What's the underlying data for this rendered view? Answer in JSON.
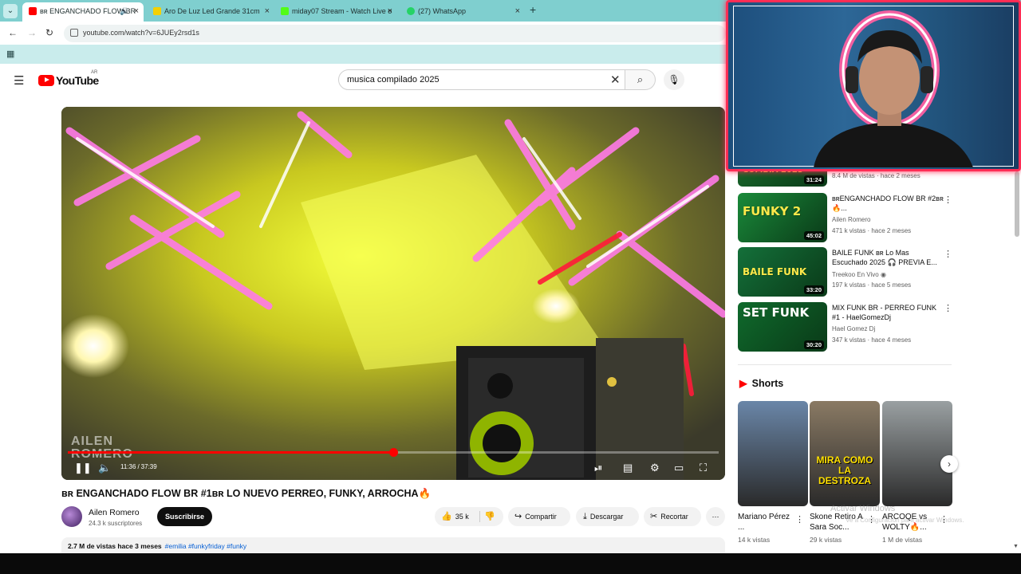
{
  "browser": {
    "tabs": [
      {
        "title": "ʙʀ ENGANCHADO FLOW BR",
        "active": true,
        "favicon_color": "#ff0000"
      },
      {
        "title": "Aro De Luz Led Grande 31cm",
        "active": false,
        "favicon_color": "#f5d000"
      },
      {
        "title": "miday07 Stream - Watch Live o",
        "active": false,
        "favicon_color": "#53fc18"
      },
      {
        "title": "(27) WhatsApp",
        "active": false,
        "favicon_color": "#25d366"
      }
    ],
    "url": "youtube.com/watch?v=6JUEy2rsd1s",
    "close_glyph": "×",
    "new_tab_glyph": "+"
  },
  "youtube": {
    "logo_text": "YouTube",
    "country_code": "AR",
    "search_query": "musica compilado 2025"
  },
  "player": {
    "current_time": "11:36",
    "duration": "37:39",
    "progress": 0.5,
    "watermark": [
      "AILEN",
      "ROMERO"
    ]
  },
  "video": {
    "title": "ʙʀ ENGANCHADO FLOW BR #1ʙʀ LO NUEVO PERREO, FUNKY, ARROCHA🔥",
    "channel": "Ailen Romero",
    "subscribers": "24.3 k suscriptores",
    "subscribe_label": "Suscribirse",
    "likes": "35 k",
    "share_label": "Compartir",
    "download_label": "Descargar",
    "clip_label": "Recortar",
    "description_meta": "2.7 M de vistas  hace 3 meses",
    "hashtags": "#emilia #funkyfriday #funky"
  },
  "sidebar": {
    "related": [
      {
        "title": "",
        "channel": "",
        "meta": "8.4 M de vistas · hace 2 meses",
        "duration": "31:24",
        "thumb_text": "CUMBIA 2025",
        "thumb_color": "#1b6f2e"
      },
      {
        "title": "ʙʀENGANCHADO FLOW BR #2ʙʀ 🔥...",
        "channel": "Ailen Romero",
        "meta": "471 k vistas · hace 2 meses",
        "duration": "45:02",
        "thumb_text": "FUNKY 2",
        "thumb_color": "#1a8a3a"
      },
      {
        "title": "BAILE FUNK ʙʀ Lo Mas Escuchado 2025 🎧 PREVIA E...",
        "channel": "Treekoo En Vivo",
        "meta": "197 k vistas · hace 5 meses",
        "duration": "33:20",
        "thumb_text": "BAILE FUNK",
        "thumb_color": "#14703a"
      },
      {
        "title": "MIX FUNK BR - PERREO FUNK #1 - HaelGomezDj",
        "channel": "Hael Gomez Dj",
        "meta": "347 k vistas · hace 4 meses",
        "duration": "30:20",
        "thumb_text": "SET FUNK",
        "thumb_color": "#0f6a2c"
      }
    ],
    "shorts_heading": "Shorts",
    "shorts": [
      {
        "title": "Mariano Pérez ...",
        "views": "14 k vistas",
        "caption": "",
        "bg": "#6a86a8"
      },
      {
        "title": "Skone Retiro A Sara Soc...",
        "views": "29 k vistas",
        "caption": "MIRA COMO LA DESTROZA",
        "bg": "#8a7a64"
      },
      {
        "title": "ARCOQE vs WOLTY🔥...",
        "views": "1 M de vistas",
        "caption": "",
        "bg": "#9aa0a2"
      }
    ],
    "windows_watermark": "Activar Windows",
    "windows_watermark_sub": "Ve a Configuración para activar Windows."
  }
}
